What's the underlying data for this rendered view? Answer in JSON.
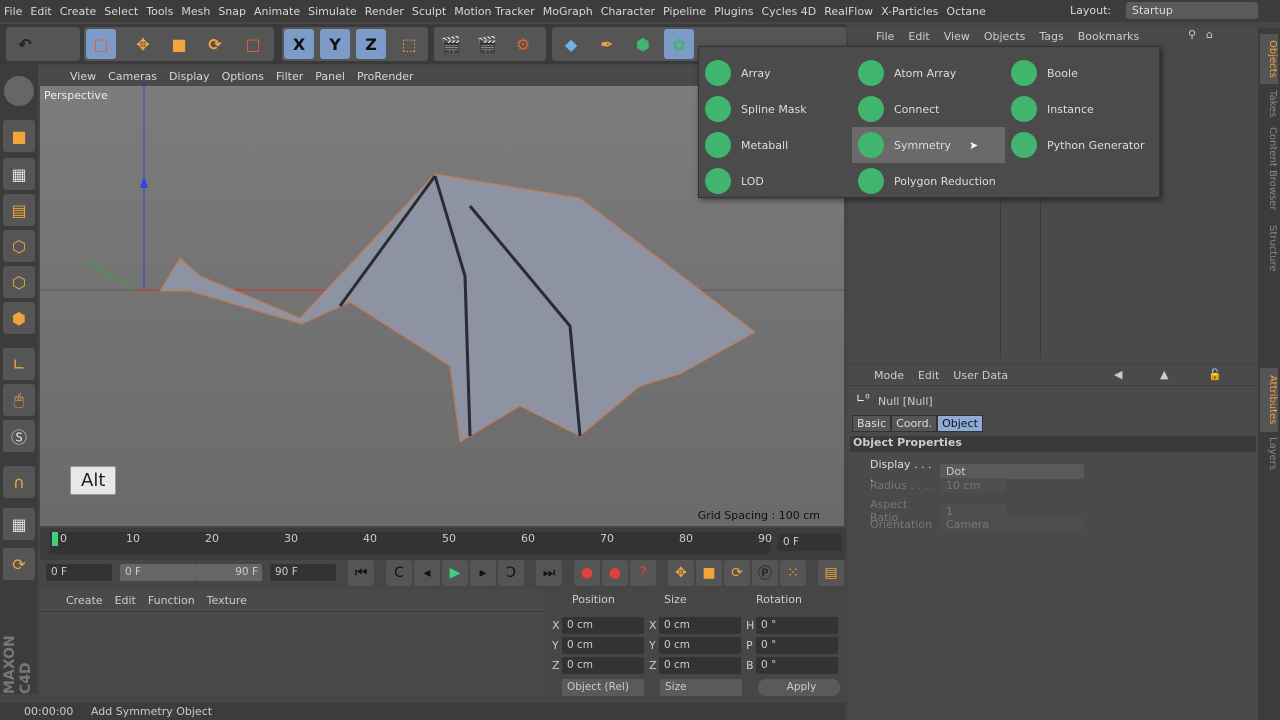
{
  "menu": [
    "File",
    "Edit",
    "Create",
    "Select",
    "Tools",
    "Mesh",
    "Snap",
    "Animate",
    "Simulate",
    "Render",
    "Sculpt",
    "Motion Tracker",
    "MoGraph",
    "Character",
    "Pipeline",
    "Plugins",
    "Cycles 4D",
    "RealFlow",
    "X-Particles",
    "Octane"
  ],
  "layout": {
    "label": "Layout:",
    "value": "Startup"
  },
  "toolbar": {
    "x": "X",
    "y": "Y",
    "z": "Z"
  },
  "viewport": {
    "menu": [
      "View",
      "Cameras",
      "Display",
      "Options",
      "Filter",
      "Panel",
      "ProRender"
    ],
    "label": "Perspective",
    "grid": "Grid Spacing : 100 cm",
    "alt_key": "Alt"
  },
  "timeline": {
    "ticks": [
      "0",
      "10",
      "20",
      "30",
      "40",
      "50",
      "60",
      "70",
      "80",
      "90"
    ],
    "current": "0 F",
    "start": "0 F",
    "range_start": "0 F",
    "range_end": "90 F",
    "end": "90 F"
  },
  "material": {
    "menu": [
      "Create",
      "Edit",
      "Function",
      "Texture"
    ]
  },
  "coords": {
    "headers": [
      "Position",
      "Size",
      "Rotation"
    ],
    "rows": [
      [
        "X",
        "0 cm",
        "X",
        "0 cm",
        "H",
        "0 °"
      ],
      [
        "Y",
        "0 cm",
        "Y",
        "0 cm",
        "P",
        "0 °"
      ],
      [
        "Z",
        "0 cm",
        "Z",
        "0 cm",
        "B",
        "0 °"
      ]
    ],
    "mode": "Object (Rel)",
    "size_mode": "Size",
    "apply": "Apply"
  },
  "status": {
    "time": "00:00:00",
    "message": "Add Symmetry Object"
  },
  "objects": {
    "menu": [
      "File",
      "Edit",
      "View",
      "Objects",
      "Tags",
      "Bookmarks"
    ]
  },
  "attributes": {
    "menu": [
      "Mode",
      "Edit",
      "User Data"
    ],
    "object": "Null [Null]",
    "tabs": [
      "Basic",
      "Coord.",
      "Object"
    ],
    "section": "Object Properties",
    "props": [
      {
        "label": "Display . . . .",
        "value": "Dot"
      },
      {
        "label": "Radius . . . .",
        "value": "10 cm"
      },
      {
        "label": "Aspect Ratio",
        "value": "1"
      },
      {
        "label": "Orientation",
        "value": "Camera"
      }
    ]
  },
  "popup": {
    "items": [
      "Array",
      "Atom Array",
      "Boole",
      "Spline Mask",
      "Connect",
      "Instance",
      "Metaball",
      "Symmetry",
      "Python Generator",
      "LOD",
      "Polygon Reduction"
    ]
  },
  "vtabs": [
    "Objects",
    "Takes",
    "Content Browser",
    "Structure",
    "Attributes",
    "Layers"
  ],
  "logo": "MAXON CINEMA 4D"
}
